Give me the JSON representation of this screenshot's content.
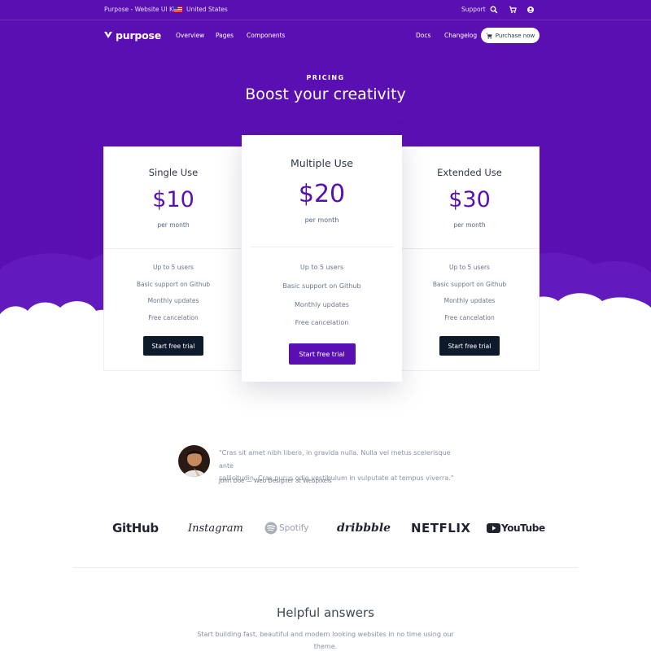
{
  "topbar": {
    "brand_text": "Purpose - Website UI Kit",
    "country": "United States",
    "support": "Support"
  },
  "nav": {
    "logo": "purpose",
    "links": [
      "Overview",
      "Pages",
      "Components"
    ],
    "right_links": [
      "Docs",
      "Changelog"
    ],
    "purchase": "Purchase now"
  },
  "hero": {
    "eyebrow": "PRICING",
    "headline": "Boost your creativity"
  },
  "pricing": [
    {
      "title": "Single Use",
      "price": "$10",
      "period": "per month",
      "features": [
        "Up to 5 users",
        "Basic support on Github",
        "Monthly updates",
        "Free cancelation"
      ],
      "cta": "Start free trial"
    },
    {
      "title": "Multiple Use",
      "price": "$20",
      "period": "per month",
      "features": [
        "Up to 5 users",
        "Basic support on Github",
        "Monthly updates",
        "Free cancelation"
      ],
      "cta": "Start free trial"
    },
    {
      "title": "Extended Use",
      "price": "$30",
      "period": "per month",
      "features": [
        "Up to 5 users",
        "Basic support on Github",
        "Monthly updates",
        "Free cancelation"
      ],
      "cta": "Start free trial"
    }
  ],
  "testimonial": {
    "quote_line1": "\"Cras sit amet nibh libero, in gravida nulla. Nulla vel metus scelerisque ante",
    "quote_line2": "sollicitudin. Cras purus odio vestibulum in vulputate at tempus viverra.\"",
    "author": "John Doe — Web Designer at Webpixels"
  },
  "brands": [
    "GitHub",
    "Instagram",
    "Spotify",
    "dribbble",
    "NETFLIX",
    "YouTube"
  ],
  "answers": {
    "title": "Helpful answers",
    "subtitle_line1": "Start building fast, beautiful and modern looking websites in no time using our",
    "subtitle_line2": "theme."
  },
  "colors": {
    "primary": "#5a0fb3",
    "dark_button": "#0c1a2b",
    "text": "#3c4858",
    "muted": "#8492a6"
  },
  "icons": [
    "search-icon",
    "cart-icon",
    "user-icon",
    "logo-icon",
    "us-flag-icon"
  ]
}
